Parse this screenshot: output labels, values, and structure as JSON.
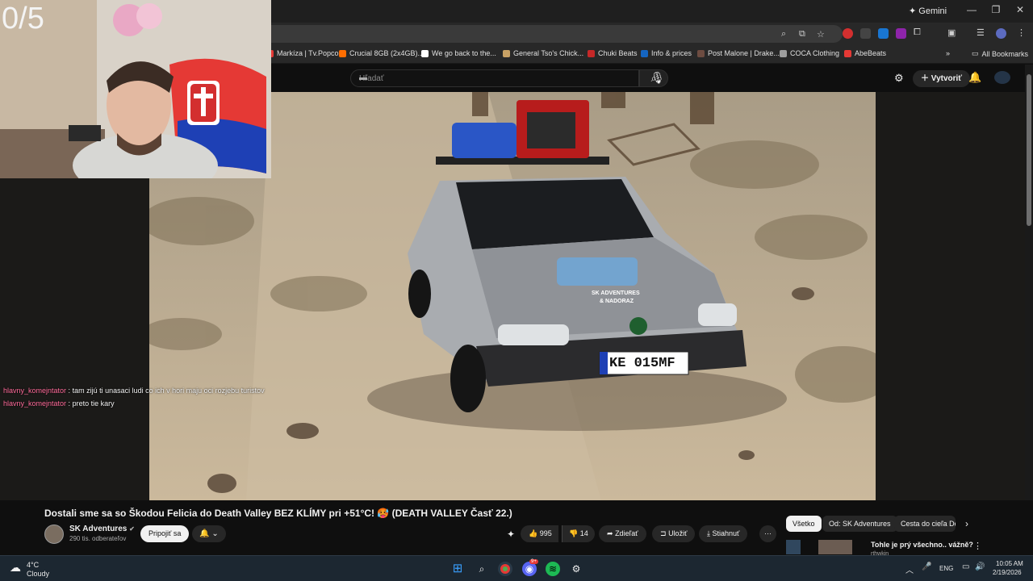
{
  "stream_overlay": {
    "counter": "0/5",
    "chat": [
      {
        "user": "hlavny_komejntator",
        "message": "tam zijú ti unasaci ludi co ich v hori maju oci rozjebu turistov"
      },
      {
        "user": "hlavny_komejntator",
        "message": "preto tie kary"
      }
    ]
  },
  "browser": {
    "gemini_label": "Gemini",
    "bookmarks": [
      {
        "label": "Markíza | Tv.Popcor...",
        "color": "#e53935"
      },
      {
        "label": "Crucial 8GB (2x4GB)...",
        "color": "#ff6d00"
      },
      {
        "label": "We go back to the...",
        "color": "#ffffff"
      },
      {
        "label": "General Tso's Chick...",
        "color": "#c8a165"
      },
      {
        "label": "Chuki Beats",
        "color": "#c62828"
      },
      {
        "label": "Info & prices",
        "color": "#1565c0"
      },
      {
        "label": "Post Malone | Drake...",
        "color": "#6d4c41"
      },
      {
        "label": "COCA Clothing",
        "color": "#9e9e9e"
      },
      {
        "label": "AbeBeats",
        "color": "#e53935"
      }
    ],
    "all_bookmarks": "All Bookmarks"
  },
  "youtube": {
    "search_placeholder": "Hľadať",
    "create_label": "Vytvoriť",
    "video_title": "Dostali sme sa so Škodou Felicia do Death Valley BEZ KLÍMY pri +51°C! 🥵 (DEATH VALLEY Časť 22.)",
    "channel_name": "SK Adventures",
    "subscribers": "290 tis. odberateľov",
    "join_label": "Pripojiť sa",
    "likes": "995",
    "dislikes": "14",
    "share_label": "Zdieľať",
    "save_label": "Uložiť",
    "download_label": "Stiahnuť",
    "chips": [
      "Všetko",
      "Od: SK Adventures",
      "Cesta do cieľa Do"
    ],
    "next_video_title": "Tohle je prý všechno.. vážně?",
    "next_video_channel": "rthwkin",
    "license_plate": "KE 015MF",
    "hood_text_1": "SK ADVENTURES",
    "hood_text_2": "& NADORAZ"
  },
  "taskbar": {
    "temperature": "4°C",
    "weather": "Cloudy",
    "language": "ENG",
    "time": "10:05 AM",
    "date": "2/19/2026",
    "discord_badge": "9+"
  }
}
